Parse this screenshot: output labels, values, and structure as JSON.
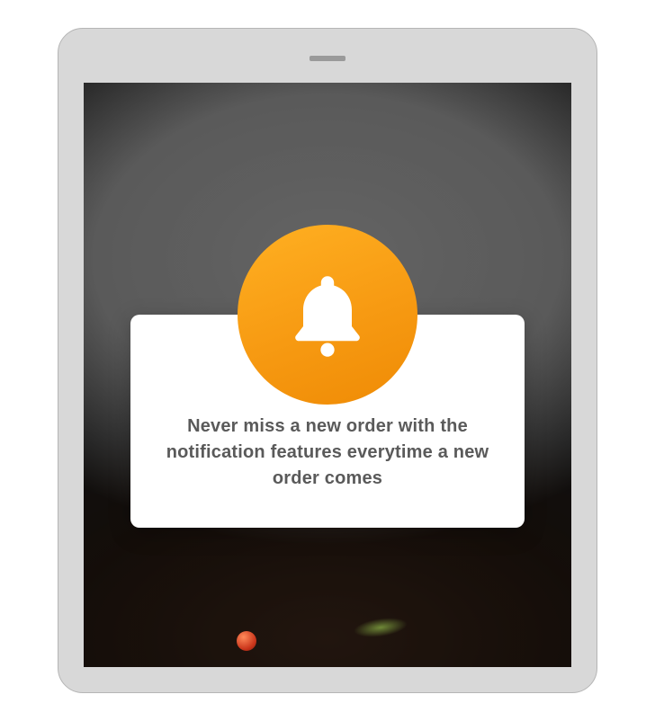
{
  "modal": {
    "icon": "bell-icon",
    "message": "Never miss a new order with the notification features everytime a new order comes"
  },
  "colors": {
    "accent_gradient_start": "#ffb022",
    "accent_gradient_end": "#ef8b05",
    "text": "#5a5a5a",
    "frame": "#d8d8d8"
  }
}
